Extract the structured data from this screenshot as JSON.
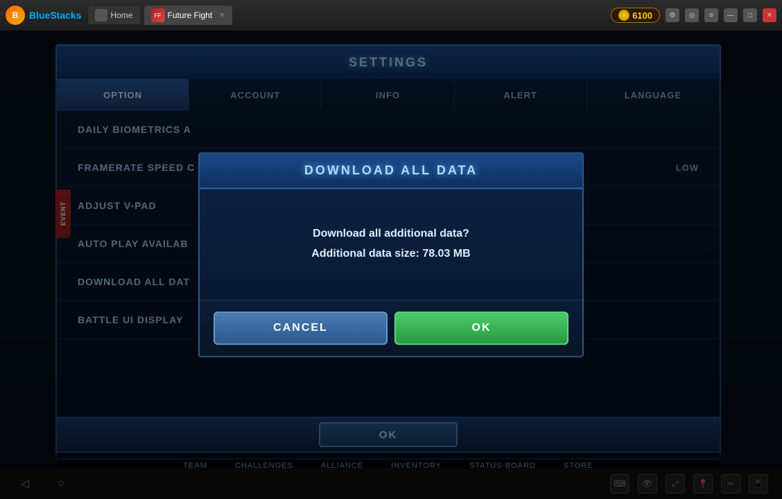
{
  "titlebar": {
    "brand": "BlueStacks",
    "tabs": [
      {
        "label": "Home",
        "active": false
      },
      {
        "label": "Future Fight",
        "active": true
      }
    ],
    "coin_amount": "6100",
    "window_controls": {
      "minimize": "—",
      "maximize": "□",
      "close": "✕"
    }
  },
  "settings": {
    "title": "SETTINGS",
    "tabs": [
      {
        "label": "OPTION",
        "active": true
      },
      {
        "label": "ACCOUNT",
        "active": false
      },
      {
        "label": "INFO",
        "active": false
      },
      {
        "label": "ALERT",
        "active": false
      },
      {
        "label": "LANGUAGE",
        "active": false
      }
    ],
    "rows": [
      {
        "label": "DAILY BIOMETRICS A",
        "value": ""
      },
      {
        "label": "FRAMERATE SPEED C",
        "value": "LOW"
      },
      {
        "label": "ADJUST V-PAD",
        "value": ""
      },
      {
        "label": "AUTO PLAY AVAILAB",
        "value": ""
      },
      {
        "label": "DOWNLOAD ALL DAT",
        "value": ""
      },
      {
        "label": "BATTLE UI DISPLAY",
        "value": ""
      }
    ],
    "ok_button": "OK"
  },
  "modal": {
    "title": "DOWNLOAD ALL DATA",
    "body_line1": "Download all additional data?",
    "body_line2": "Additional data size: 78.03 MB",
    "cancel_button": "CANCEL",
    "ok_button": "OK"
  },
  "bottom_nav": {
    "items": [
      "TEAM",
      "CHALLENGES",
      "ALLIANCE",
      "INVENTORY",
      "STATUS BOARD",
      "STORE"
    ]
  },
  "device_nav": {
    "back": "◁",
    "home": "○",
    "icons": [
      "⌨",
      "👁",
      "⤢",
      "📍",
      "✂",
      "📱"
    ]
  },
  "left_tab": {
    "label": "EVENT"
  }
}
